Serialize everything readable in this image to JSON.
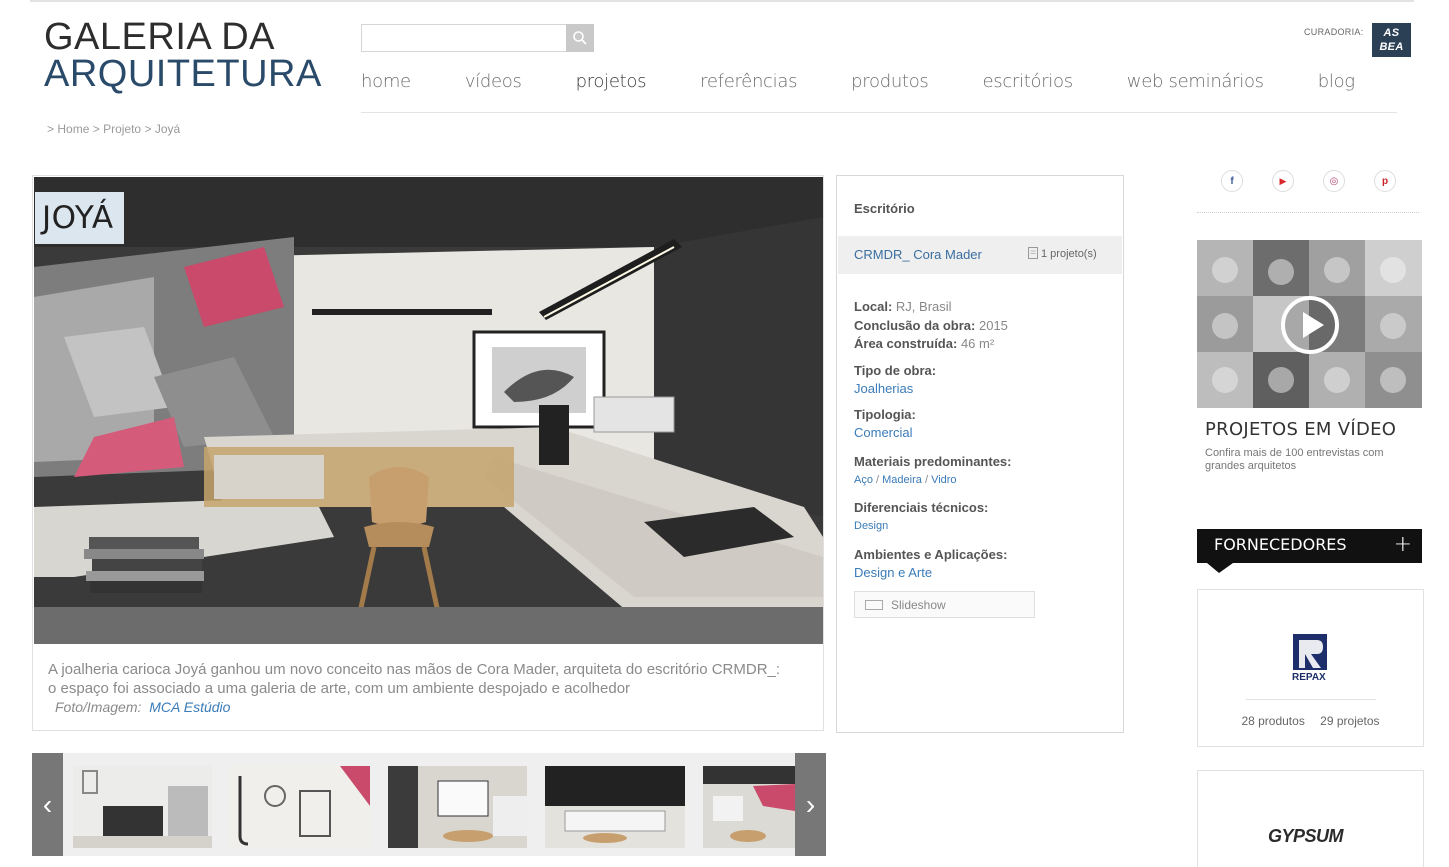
{
  "header": {
    "logo_line1": "GALERIA DA",
    "logo_line2": "ARQUITETURA",
    "search_placeholder": "",
    "curadoria_label": "CURADORIA:",
    "asbea_line1": "AS",
    "asbea_line2": "BEA",
    "nav": [
      {
        "label": "home"
      },
      {
        "label": "vídeos"
      },
      {
        "label": "projetos"
      },
      {
        "label": "referências"
      },
      {
        "label": "produtos"
      },
      {
        "label": "escritórios"
      },
      {
        "label": "web seminários"
      },
      {
        "label": "blog"
      }
    ],
    "active_nav": "projetos"
  },
  "breadcrumb": {
    "sep": ">",
    "items": [
      "Home",
      "Projeto",
      "Joyá"
    ]
  },
  "project": {
    "title": "JOYÁ",
    "description": "A joalheria carioca Joyá ganhou um novo conceito nas mãos de Cora Mader, arquiteta do escritório CRMDR_: o espaço foi associado a uma galeria de arte, com um ambiente despojado e acolhedor",
    "credit_label": "Foto/Imagem:",
    "credit_name": "MCA Estúdio"
  },
  "info": {
    "header": "Escritório",
    "office_name": "CRMDR_ Cora Mader",
    "office_count": "1 projeto(s)",
    "local_label": "Local:",
    "local_value": "RJ, Brasil",
    "conclusao_label": "Conclusão da obra:",
    "conclusao_value": "2015",
    "area_label": "Área construída:",
    "area_value": "46 m²",
    "tipo_label": "Tipo de obra:",
    "tipo_value": "Joalherias",
    "tipologia_label": "Tipologia:",
    "tipologia_value": "Comercial",
    "materiais_label": "Materiais predominantes:",
    "materiais": [
      "Aço",
      "Madeira",
      "Vidro"
    ],
    "diferenciais_label": "Diferenciais técnicos:",
    "diferenciais_value": "Design",
    "ambientes_label": "Ambientes e Aplicações:",
    "ambientes_value": "Design e Arte",
    "slideshow_label": "Slideshow"
  },
  "sidebar": {
    "social": [
      {
        "name": "facebook-icon",
        "glyph": "f",
        "color": "#3b5998"
      },
      {
        "name": "youtube-icon",
        "glyph": "▶",
        "color": "#d9252a"
      },
      {
        "name": "instagram-icon",
        "glyph": "◎",
        "color": "#b0416b"
      },
      {
        "name": "pinterest-icon",
        "glyph": "p",
        "color": "#cb2027"
      }
    ],
    "video_title": "PROJETOS EM VÍDEO",
    "video_subtitle": "Confira mais de 100 entrevistas com grandes arquitetos",
    "fornecedores_label": "FORNECEDORES",
    "fornecedores_plus": "+",
    "supplier1": {
      "logo_text": "REPAX",
      "produtos": "28 produtos",
      "projetos": "29 projetos"
    },
    "supplier2": {
      "logo_text": "GYPSUM"
    }
  },
  "carousel": {
    "prev_glyph": "‹",
    "next_glyph": "›"
  },
  "colors": {
    "link": "#3a7bb8",
    "logo_blue": "#2a4a6a",
    "fornecedores_bg": "#111111"
  }
}
